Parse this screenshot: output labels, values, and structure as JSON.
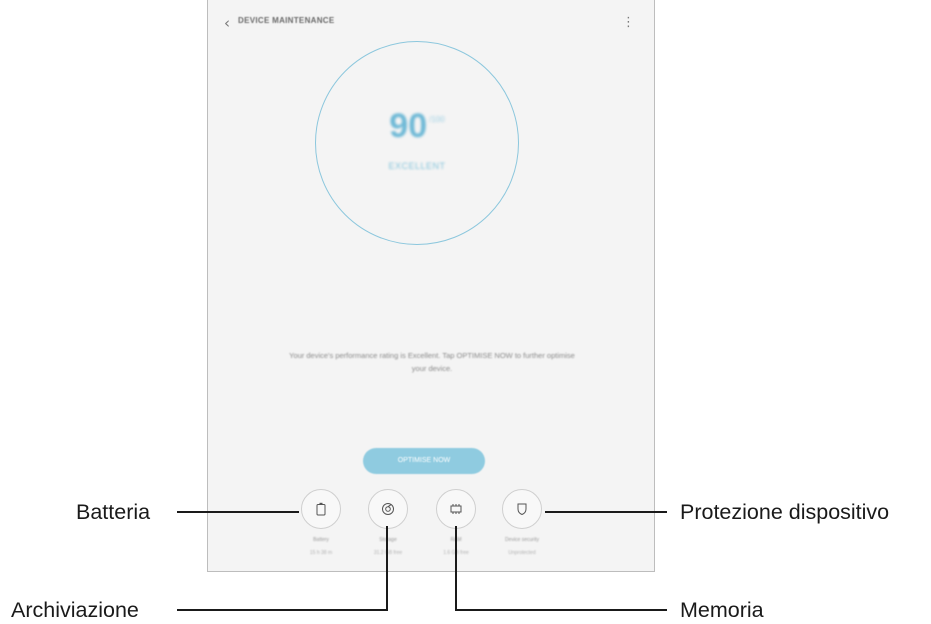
{
  "app": {
    "title": "DEVICE MAINTENANCE",
    "back_glyph": "‹",
    "menu_glyph": "⋮",
    "icons": [
      "back-arrow-icon",
      "more-options-icon",
      "battery-icon",
      "storage-icon",
      "memory-chip-icon",
      "shield-icon"
    ]
  },
  "score": {
    "value": "90",
    "unit": "/100",
    "status": "EXCELLENT"
  },
  "message": "Your device's performance rating is Excellent. Tap OPTIMISE NOW to further optimise your device.",
  "optimize_button": "OPTIMISE NOW",
  "tiles": [
    {
      "name": "Battery",
      "value": "15 h 38 m"
    },
    {
      "name": "Storage",
      "value": "31.2 GB free"
    },
    {
      "name": "RAM",
      "value": "1.6 GB free"
    },
    {
      "name": "Device security",
      "value": "Unprotected"
    }
  ],
  "callouts": {
    "battery": "Batteria",
    "storage": "Archiviazione",
    "security": "Protezione dispositivo",
    "memory": "Memoria"
  },
  "colors": {
    "accent": "#6fb9d6",
    "gauge_ring": "#8cc7dd",
    "button": "#8fcbe0",
    "screen_bg": "#f4f4f4"
  }
}
